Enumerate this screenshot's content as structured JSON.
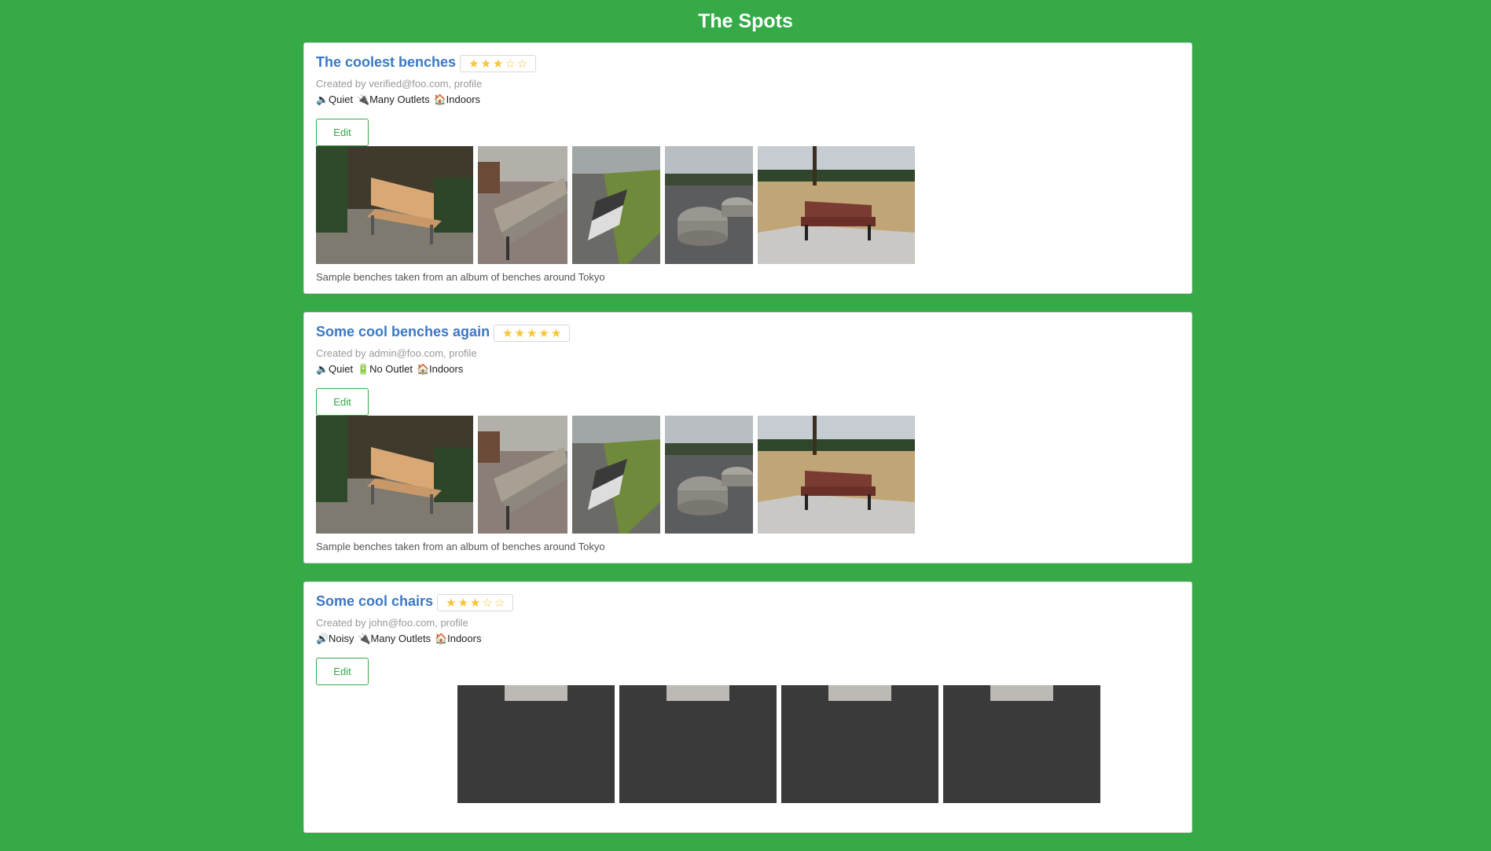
{
  "page": {
    "title": "The Spots"
  },
  "spots": [
    {
      "title": "The coolest benches",
      "rating": 3,
      "creator_text": "Created by verified@foo.com, profile",
      "tags": [
        {
          "icon": "speaker-quiet-icon",
          "glyph": "🔈",
          "label": "Quiet"
        },
        {
          "icon": "plug-icon",
          "glyph": "🔌",
          "label": "Many Outlets"
        },
        {
          "icon": "house-icon",
          "glyph": "🏠",
          "label": "Indoors"
        }
      ],
      "edit_label": "Edit",
      "description": "Sample benches taken from an album of benches around Tokyo"
    },
    {
      "title": "Some cool benches again",
      "rating": 5,
      "creator_text": "Created by admin@foo.com, profile",
      "tags": [
        {
          "icon": "speaker-quiet-icon",
          "glyph": "🔈",
          "label": "Quiet"
        },
        {
          "icon": "battery-icon",
          "glyph": "🔋",
          "label": "No Outlet"
        },
        {
          "icon": "house-icon",
          "glyph": "🏠",
          "label": "Indoors"
        }
      ],
      "edit_label": "Edit",
      "description": "Sample benches taken from an album of benches around Tokyo"
    },
    {
      "title": "Some cool chairs",
      "rating": 3,
      "creator_text": "Created by john@foo.com, profile",
      "tags": [
        {
          "icon": "speaker-loud-icon",
          "glyph": "🔊",
          "label": "Noisy"
        },
        {
          "icon": "plug-icon",
          "glyph": "🔌",
          "label": "Many Outlets"
        },
        {
          "icon": "house-icon",
          "glyph": "🏠",
          "label": "Indoors"
        }
      ],
      "edit_label": "Edit",
      "description": ""
    }
  ],
  "colors": {
    "background": "#35aa47",
    "title_link": "#3b78c4",
    "star": "#f7c433"
  }
}
